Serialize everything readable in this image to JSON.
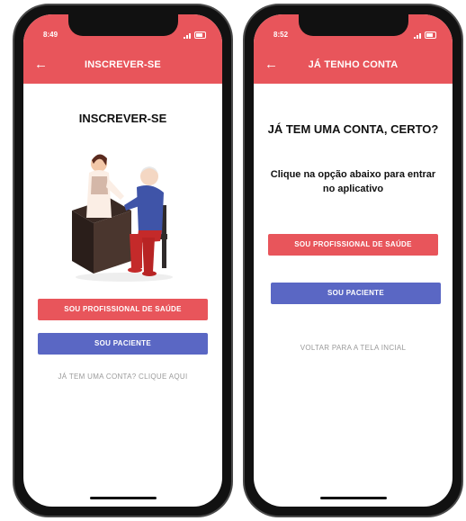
{
  "signup_screen": {
    "status_time": "8:49",
    "header_title": "INSCREVER-SE",
    "page_heading": "INSCREVER-SE",
    "btn_professional": "SOU PROFISSIONAL DE SAÚDE",
    "btn_patient": "SOU PACIENTE",
    "link_login": "JÁ TEM UMA CONTA? CLIQUE AQUI"
  },
  "account_screen": {
    "status_time": "8:52",
    "header_title": "JÁ TENHO CONTA",
    "page_heading": "JÁ TEM UMA CONTA, CERTO?",
    "subtitle": "Clique na opção abaixo para  entrar no aplicativo",
    "btn_professional": "SOU PROFISSIONAL DE SAÚDE",
    "btn_patient": "SOU PACIENTE",
    "link_back": "VOLTAR PARA A TELA INCIAL"
  },
  "colors": {
    "primary_red": "#e8555b",
    "primary_blue": "#5a67c4",
    "link_gray": "#9a9a9a"
  },
  "icons": [
    "back-arrow-icon",
    "signal-icon",
    "battery-icon",
    "doctor-patient-illustration"
  ]
}
